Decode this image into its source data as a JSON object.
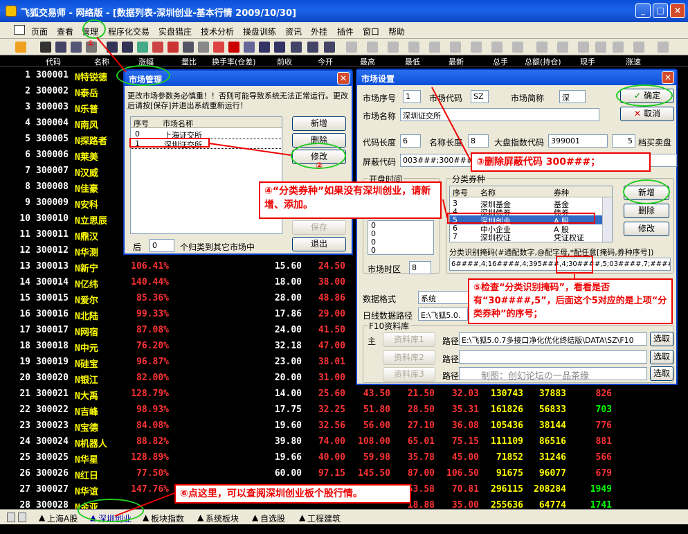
{
  "app": {
    "title": "飞狐交易师 - 网络版 - [数据列表-深圳创业-基本行情 2009/10/30]",
    "window_controls": [
      "_",
      "□",
      "×"
    ]
  },
  "menu": [
    "页面",
    "查看",
    "管理",
    "程序化交易",
    "实盘猎庄",
    "技术分析",
    "操盘训练",
    "资讯",
    "外挂",
    "插件",
    "窗口",
    "帮助"
  ],
  "grid": {
    "headers": [
      "代码",
      "名称",
      "涨幅",
      "量比",
      "换手率(仓差)",
      "前收",
      "今开",
      "最高",
      "最低",
      "最新",
      "总手",
      "总额(持仓)",
      "现手",
      "涨速"
    ],
    "rows": [
      [
        "1",
        "300001",
        "N特锐德",
        "",
        "",
        "",
        "",
        "",
        "",
        "",
        "",
        "",
        ""
      ],
      [
        "2",
        "300002",
        "N泰岳",
        "",
        "",
        "",
        "",
        "",
        "",
        "",
        "",
        "",
        ""
      ],
      [
        "3",
        "300003",
        "N乐普",
        "",
        "",
        "",
        "",
        "",
        "",
        "",
        "",
        "",
        ""
      ],
      [
        "4",
        "300004",
        "N南风",
        "",
        "",
        "",
        "",
        "",
        "",
        "",
        "",
        "",
        ""
      ],
      [
        "5",
        "300005",
        "N探路者",
        "",
        "",
        "",
        "",
        "",
        "",
        "",
        "",
        "",
        ""
      ],
      [
        "6",
        "300006",
        "N莱美",
        "",
        "",
        "",
        "",
        "",
        "",
        "",
        "",
        "",
        ""
      ],
      [
        "7",
        "300007",
        "N汉威",
        "",
        "",
        "",
        "",
        "",
        "",
        "",
        "",
        "",
        ""
      ],
      [
        "8",
        "300008",
        "N佳豪",
        "",
        "",
        "",
        "",
        "",
        "",
        "",
        "",
        "",
        ""
      ],
      [
        "9",
        "300009",
        "N安科",
        "",
        "",
        "",
        "",
        "",
        "",
        "",
        "",
        "",
        ""
      ],
      [
        "10",
        "300010",
        "N立思辰",
        "",
        "",
        "",
        "",
        "",
        "",
        "",
        "",
        "",
        ""
      ],
      [
        "11",
        "300011",
        "N鼎汉",
        "",
        "",
        "",
        "",
        "",
        "",
        "",
        "",
        "",
        ""
      ],
      [
        "12",
        "300012",
        "N华测",
        "",
        "",
        "",
        "",
        "",
        "",
        "",
        "",
        "",
        ""
      ],
      [
        "13",
        "300013",
        "N新宁",
        "106.41%",
        "15.60",
        "24.50",
        "",
        "",
        "",
        "",
        "",
        "",
        ""
      ],
      [
        "14",
        "300014",
        "N亿纬",
        "140.44%",
        "18.00",
        "38.00",
        "",
        "",
        "",
        "",
        "",
        "",
        ""
      ],
      [
        "15",
        "300015",
        "N爱尔",
        "85.36%",
        "28.00",
        "48.86",
        "",
        "",
        "",
        "",
        "",
        "",
        ""
      ],
      [
        "16",
        "300016",
        "N北陆",
        "99.33%",
        "17.86",
        "29.00",
        "",
        "",
        "",
        "",
        "",
        "",
        ""
      ],
      [
        "17",
        "300017",
        "N网宿",
        "87.08%",
        "24.00",
        "41.50",
        "",
        "",
        "",
        "",
        "",
        "",
        ""
      ],
      [
        "18",
        "300018",
        "N中元",
        "76.20%",
        "32.18",
        "47.00",
        "",
        "",
        "",
        "",
        "",
        "",
        ""
      ],
      [
        "19",
        "300019",
        "N硅宝",
        "96.87%",
        "23.00",
        "38.01",
        "",
        "",
        "",
        "",
        "",
        "",
        ""
      ],
      [
        "20",
        "300020",
        "N银江",
        "82.00%",
        "20.00",
        "31.00",
        "",
        "",
        "",
        "",
        "",
        "",
        ""
      ],
      [
        "21",
        "300021",
        "N大禹",
        "128.79%",
        "14.00",
        "25.60",
        "43.50",
        "21.50",
        "32.03",
        "130743",
        "37883",
        "826",
        ""
      ],
      [
        "22",
        "300022",
        "N吉峰",
        "98.93%",
        "17.75",
        "32.25",
        "51.80",
        "28.50",
        "35.31",
        "161826",
        "56833",
        "703",
        ""
      ],
      [
        "23",
        "300023",
        "N宝德",
        "84.08%",
        "19.60",
        "32.56",
        "56.00",
        "27.10",
        "36.08",
        "105436",
        "38144",
        "776",
        ""
      ],
      [
        "24",
        "300024",
        "N机器人",
        "88.82%",
        "39.80",
        "74.00",
        "108.00",
        "65.01",
        "75.15",
        "111109",
        "86516",
        "881",
        ""
      ],
      [
        "25",
        "300025",
        "N华星",
        "128.89%",
        "19.66",
        "40.00",
        "59.98",
        "35.78",
        "45.00",
        "71852",
        "31246",
        "566",
        ""
      ],
      [
        "26",
        "300026",
        "N红日",
        "77.50%",
        "60.00",
        "97.15",
        "145.50",
        "87.00",
        "106.50",
        "91675",
        "96077",
        "679",
        ""
      ],
      [
        "27",
        "300027",
        "N华谊",
        "147.76%",
        "",
        "",
        "",
        "53.58",
        "70.81",
        "296115",
        "208284",
        "1949",
        ""
      ],
      [
        "28",
        "300028",
        "N金亚",
        "",
        "",
        "",
        "",
        "18.88",
        "35.00",
        "255636",
        "64774",
        "1741",
        ""
      ]
    ]
  },
  "sheet_tabs": [
    "上海A股",
    "深圳创业",
    "板块指数",
    "系统板块",
    "自选股",
    "工程建筑"
  ],
  "market_mgmt": {
    "title": "市场管理",
    "warning": "更改市场参数务必慎重！！否则可能导致系统无法正常运行。更改后请按[保存]并退出系统重新运行！",
    "cols": [
      "序号",
      "市场名称"
    ],
    "rows": [
      [
        "0",
        "上海证交所"
      ],
      [
        "1",
        "深圳证交所"
      ]
    ],
    "buttons": [
      "新增",
      "删除",
      "修改",
      "保存",
      "退出"
    ],
    "bottom_prefix": "后",
    "bottom_value": "0",
    "bottom_suffix": "个归类到其它市场中"
  },
  "market_set": {
    "title": "市场设置",
    "seq_label": "市场序号",
    "seq": "1",
    "code_label": "市场代码",
    "code": "SZ",
    "abbr_label": "市场简称",
    "abbr": "深",
    "name_label": "市场名称",
    "name": "深圳证交所",
    "code_len_label": "代码长度",
    "code_len": "6",
    "name_len_label": "名称长度",
    "name_len": "8",
    "index_label": "大盘指数代码",
    "index_code": "399001",
    "depth": "5",
    "depth_label": "档买卖盘",
    "mask_label": "屏蔽代码",
    "mask": "003###;300###;",
    "ok": "确定",
    "cancel": "取消",
    "open_time_label": "开盘时间",
    "open_time_vals": [
      "0",
      "0",
      "0",
      "0",
      "0"
    ],
    "tz_label": "市场时区",
    "tz": "8",
    "cat_label": "分类券种",
    "cat_cols": [
      "序号",
      "名称",
      "券种"
    ],
    "cat_rows": [
      [
        "3",
        "深圳基金",
        "基金"
      ],
      [
        "4",
        "深圳债券",
        "债券"
      ],
      [
        "5",
        "深圳创业",
        "A 股"
      ],
      [
        "6",
        "中小企业",
        "A 股"
      ],
      [
        "7",
        "深圳权证",
        "凭证权证"
      ]
    ],
    "cat_buttons": [
      "新增",
      "删除",
      "修改"
    ],
    "mask_rule_label": "分类识别掩码(#通配数字,@配字母,*配任意[掩码,券种序号])",
    "mask_rule": "6####,4;16####,4;395###,4;30####,5;03####,7;######,8",
    "data_fmt_label": "数据格式",
    "data_fmt": "系统",
    "daily_path_label": "日线数据路径",
    "daily_path": "E:\\飞狐5.0.",
    "f10_label": "F10资料库",
    "main_label": "主",
    "libs": [
      {
        "btn": "资料库1",
        "path": "E:\\飞狐5.0.7多接口净化优化终结版\\DATA\\SZ\\F10"
      },
      {
        "btn": "资料库2",
        "path": ""
      },
      {
        "btn": "资料库3",
        "path": ""
      }
    ],
    "path_label": "路径",
    "browse": "选取",
    "credit": "制图：创幻论坛の一品茶缘"
  },
  "annotations": {
    "n1": "①",
    "n2": "②",
    "a3": "③删除屏蔽代码 300###；",
    "a4": "④“分类券种”如果没有深圳创业，请新增、添加。",
    "a5": "⑤检查“分类识别掩码”，看看是否有“30####,5”，后面这个5对应的是上项“分类券种”的序号；",
    "a6": "⑥点这里，可以查阅深圳创业板个股行情。"
  }
}
